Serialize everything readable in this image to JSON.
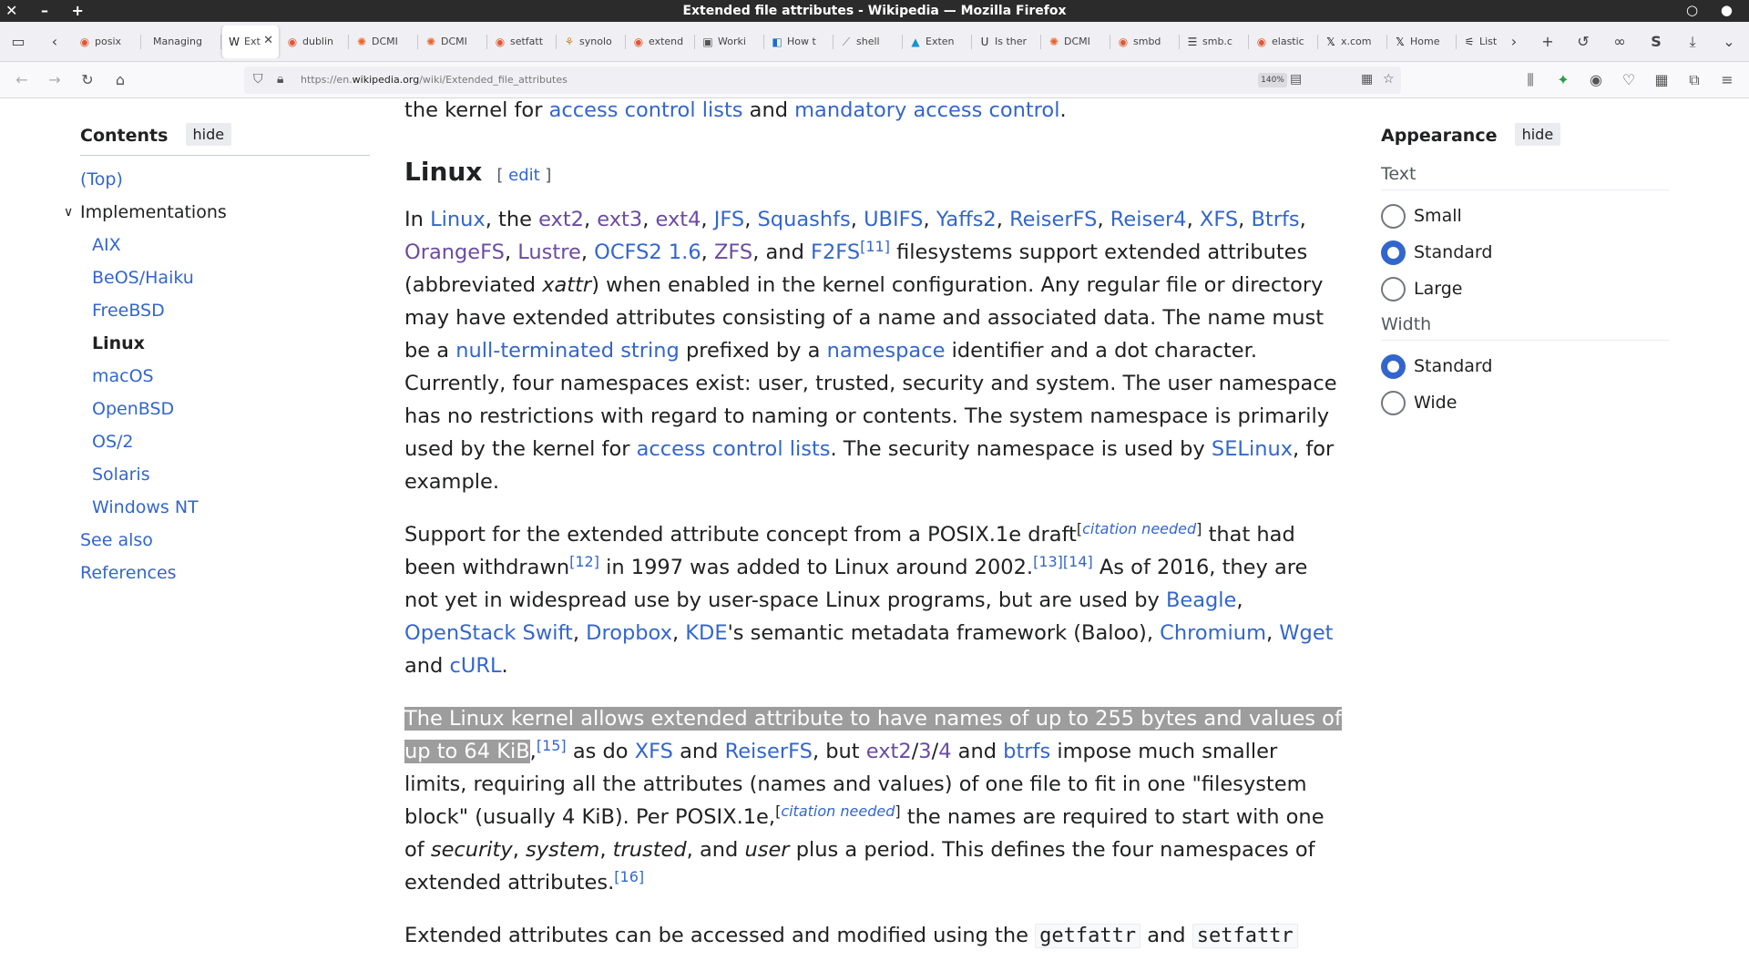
{
  "window": {
    "title": "Extended file attributes - Wikipedia — Mozilla Firefox"
  },
  "tabs": [
    {
      "label": "posix",
      "icon": "ddg-icon"
    },
    {
      "label": "Managing",
      "icon": "blank"
    },
    {
      "label": "Ext",
      "icon": "wikipedia-icon",
      "active": true
    },
    {
      "label": "dublin",
      "icon": "ddg-icon"
    },
    {
      "label": "DCMI",
      "icon": "dcmi-icon"
    },
    {
      "label": "DCMI",
      "icon": "dcmi-icon"
    },
    {
      "label": "setfatt",
      "icon": "ddg-icon"
    },
    {
      "label": "synolo",
      "icon": "synology-icon"
    },
    {
      "label": "extend",
      "icon": "ddg-icon"
    },
    {
      "label": "Worki",
      "icon": "page-icon"
    },
    {
      "label": "How t",
      "icon": "blue-icon"
    },
    {
      "label": "shell",
      "icon": "shell-icon"
    },
    {
      "label": "Exten",
      "icon": "arch-icon"
    },
    {
      "label": "Is ther",
      "icon": "unix-icon"
    },
    {
      "label": "DCMI",
      "icon": "dcmi-icon"
    },
    {
      "label": "smbd",
      "icon": "ddg-icon"
    },
    {
      "label": "smb.c",
      "icon": "list-icon"
    },
    {
      "label": "elastic",
      "icon": "ddg-icon"
    },
    {
      "label": "x.com",
      "icon": "x-icon"
    },
    {
      "label": "Home",
      "icon": "x-icon"
    },
    {
      "label": "List",
      "icon": "lists-icon"
    }
  ],
  "urlbar": {
    "prefix": "https://en.",
    "domain": "wikipedia.org",
    "path": "/wiki/Extended_file_attributes",
    "zoom": "140%"
  },
  "toc": {
    "heading": "Contents",
    "hide": "hide",
    "top": "(Top)",
    "implementations": "Implementations",
    "items": [
      "AIX",
      "BeOS/Haiku",
      "FreeBSD",
      "Linux",
      "macOS",
      "OpenBSD",
      "OS/2",
      "Solaris",
      "Windows NT"
    ],
    "see_also": "See also",
    "references": "References"
  },
  "content": {
    "prev_line": {
      "t1": "the kernel for ",
      "l1": "access control lists",
      "t2": " and ",
      "l2": "mandatory access control",
      "t3": "."
    },
    "section_title": "Linux",
    "edit": "edit",
    "p1": {
      "a": "In ",
      "linux": "Linux",
      "b": ", the ",
      "ext2": "ext2",
      "ext3": "ext3",
      "ext4": "ext4",
      "jfs": "JFS",
      "squashfs": "Squashfs",
      "ubifs": "UBIFS",
      "yaffs2": "Yaffs2",
      "reiserfs": "ReiserFS",
      "reiser4": "Reiser4",
      "xfs": "XFS",
      "btrfs": "Btrfs",
      "orangefs": "OrangeFS",
      "lustre": "Lustre",
      "ocfs2": "OCFS2 1.6",
      "zfs": "ZFS",
      "and": "and",
      "f2fs": "F2FS",
      "ref11": "[11]",
      "c": " filesystems support extended attributes (abbreviated ",
      "xattr": "xattr",
      "d": ") when enabled in the kernel configuration. Any regular file or directory may have extended attributes consisting of a name and associated data. The name must be a ",
      "nts": "null-terminated string",
      "e": " prefixed by a ",
      "ns": "namespace",
      "f": " identifier and a dot character. Currently, four namespaces exist: user, trusted, security and system. The user namespace has no restrictions with regard to naming or contents. The system namespace is primarily used by the kernel for ",
      "acl": "access control lists",
      "g": ". The security namespace is used by ",
      "selinux": "SELinux",
      "h": ", for example."
    },
    "p2": {
      "a": "Support for the extended attribute concept from a POSIX.1e draft",
      "cn": "citation needed",
      "b": " that had been withdrawn",
      "ref12": "[12]",
      "c": " in 1997 was added to Linux around 2002.",
      "ref13": "[13]",
      "ref14": "[14]",
      "d": " As of 2016, they are not yet in widespread use by user-space Linux programs, but are used by ",
      "beagle": "Beagle",
      "swift": "OpenStack Swift",
      "dropbox": "Dropbox",
      "kde": "KDE",
      "e": "'s semantic metadata framework (Baloo), ",
      "chromium": "Chromium",
      "wget": "Wget",
      "and": "and",
      "curl": "cURL"
    },
    "p3": {
      "sel": "The Linux kernel allows extended attribute to have names of up to 255 bytes and values of up to 64 KiB",
      "ref15": "[15]",
      "a": " as do ",
      "xfs": "XFS",
      "b": " and ",
      "reiserfs": "ReiserFS",
      "c": ", but ",
      "ext2": "ext2",
      "ext3": "3",
      "ext4": "4",
      "d": " and ",
      "btrfs": "btrfs",
      "e": " impose much smaller limits, requiring all the attributes (names and values) of one file to fit in one \"filesystem block\" (usually 4 KiB). Per POSIX.1e,",
      "cn": "citation needed",
      "f": " the names are required to start with one of ",
      "security": "security",
      "system": "system",
      "trusted": "trusted",
      "and": "and",
      "user": "user",
      "g": " plus a period. This defines the four namespaces of extended attributes.",
      "ref16": "[16]"
    },
    "p4": {
      "a": "Extended attributes can be accessed and modified using the ",
      "getfattr": "getfattr",
      "b": " and ",
      "setfattr": "setfattr"
    }
  },
  "appearance": {
    "heading": "Appearance",
    "hide": "hide",
    "text_label": "Text",
    "text_options": [
      "Small",
      "Standard",
      "Large"
    ],
    "text_selected": "Standard",
    "width_label": "Width",
    "width_options": [
      "Standard",
      "Wide"
    ],
    "width_selected": "Standard"
  },
  "colors": {
    "link": "#3366cc",
    "visited": "#6b4ba1",
    "selection": "#9d9d9d"
  }
}
